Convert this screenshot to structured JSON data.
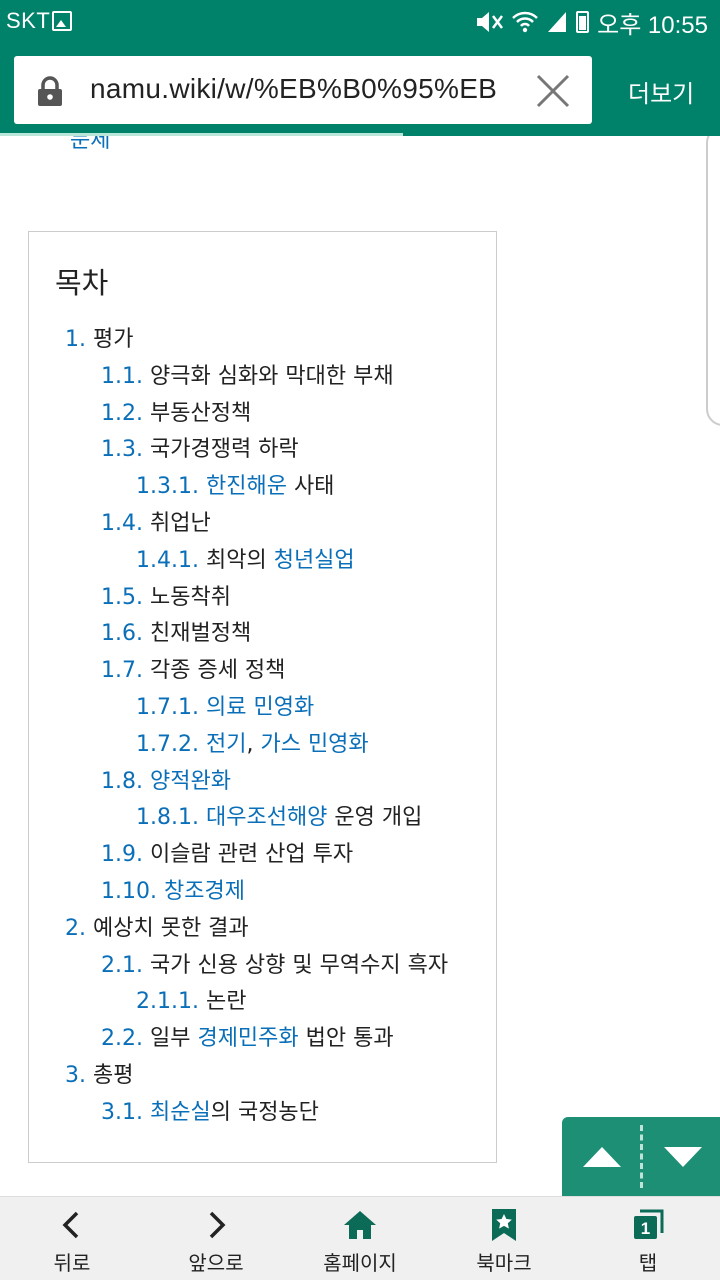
{
  "status_bar": {
    "carrier": "SKT",
    "time": "오후 10:55"
  },
  "browser": {
    "url": "namu.wiki/w/%EB%B0%95%EB",
    "more_label": "더보기"
  },
  "page": {
    "cut_text": "문제",
    "toc": {
      "title": "목차",
      "items": [
        {
          "num": "1.",
          "parts": [
            {
              "t": " 평가",
              "link": false
            }
          ],
          "level": 1
        },
        {
          "num": "1.1.",
          "parts": [
            {
              "t": " 양극화 심화와 막대한 부채",
              "link": false
            }
          ],
          "level": 2
        },
        {
          "num": "1.2.",
          "parts": [
            {
              "t": " 부동산정책",
              "link": false
            }
          ],
          "level": 2
        },
        {
          "num": "1.3.",
          "parts": [
            {
              "t": " 국가경쟁력 하락",
              "link": false
            }
          ],
          "level": 2
        },
        {
          "num": "1.3.1.",
          "parts": [
            {
              "t": " ",
              "link": false
            },
            {
              "t": "한진해운",
              "link": true
            },
            {
              "t": " 사태",
              "link": false
            }
          ],
          "level": 3
        },
        {
          "num": "1.4.",
          "parts": [
            {
              "t": " 취업난",
              "link": false
            }
          ],
          "level": 2
        },
        {
          "num": "1.4.1.",
          "parts": [
            {
              "t": " 최악의 ",
              "link": false
            },
            {
              "t": "청년실업",
              "link": true
            }
          ],
          "level": 3
        },
        {
          "num": "1.5.",
          "parts": [
            {
              "t": " 노동착취",
              "link": false
            }
          ],
          "level": 2
        },
        {
          "num": "1.6.",
          "parts": [
            {
              "t": " 친재벌정책",
              "link": false
            }
          ],
          "level": 2
        },
        {
          "num": "1.7.",
          "parts": [
            {
              "t": " 각종 증세 정책",
              "link": false
            }
          ],
          "level": 2
        },
        {
          "num": "1.7.1.",
          "parts": [
            {
              "t": " ",
              "link": false
            },
            {
              "t": "의료 민영화",
              "link": true
            }
          ],
          "level": 3
        },
        {
          "num": "1.7.2.",
          "parts": [
            {
              "t": " ",
              "link": false
            },
            {
              "t": "전기",
              "link": true
            },
            {
              "t": ", ",
              "link": false
            },
            {
              "t": "가스 민영화",
              "link": true
            }
          ],
          "level": 3
        },
        {
          "num": "1.8.",
          "parts": [
            {
              "t": " ",
              "link": false
            },
            {
              "t": "양적완화",
              "link": true
            }
          ],
          "level": 2
        },
        {
          "num": "1.8.1.",
          "parts": [
            {
              "t": " ",
              "link": false
            },
            {
              "t": "대우조선해양",
              "link": true
            },
            {
              "t": " 운영 개입",
              "link": false
            }
          ],
          "level": 3
        },
        {
          "num": "1.9.",
          "parts": [
            {
              "t": " 이슬람 관련 산업 투자",
              "link": false
            }
          ],
          "level": 2
        },
        {
          "num": "1.10.",
          "parts": [
            {
              "t": " ",
              "link": false
            },
            {
              "t": "창조경제",
              "link": true
            }
          ],
          "level": 2
        },
        {
          "num": "2.",
          "parts": [
            {
              "t": " 예상치 못한 결과",
              "link": false
            }
          ],
          "level": 1
        },
        {
          "num": "2.1.",
          "parts": [
            {
              "t": " 국가 신용 상향 및 무역수지 흑자",
              "link": false
            }
          ],
          "level": 2
        },
        {
          "num": "2.1.1.",
          "parts": [
            {
              "t": " 논란",
              "link": false
            }
          ],
          "level": 3
        },
        {
          "num": "2.2.",
          "parts": [
            {
              "t": " 일부 ",
              "link": false
            },
            {
              "t": "경제민주화",
              "link": true
            },
            {
              "t": " 법안 통과",
              "link": false
            }
          ],
          "level": 2
        },
        {
          "num": "3.",
          "parts": [
            {
              "t": " 총평",
              "link": false
            }
          ],
          "level": 1
        },
        {
          "num": "3.1.",
          "parts": [
            {
              "t": " ",
              "link": false
            },
            {
              "t": "최순실",
              "link": true
            },
            {
              "t": "의 국정농단",
              "link": false
            }
          ],
          "level": 2
        }
      ]
    }
  },
  "bottom_nav": {
    "back": "뒤로",
    "forward": "앞으로",
    "home": "홈페이지",
    "bookmarks": "북마크",
    "tabs": "탭",
    "tab_count": "1"
  },
  "colors": {
    "toolbar": "#00826a",
    "link": "#0a6fb8",
    "scroll_buttons": "#1c8f75"
  }
}
